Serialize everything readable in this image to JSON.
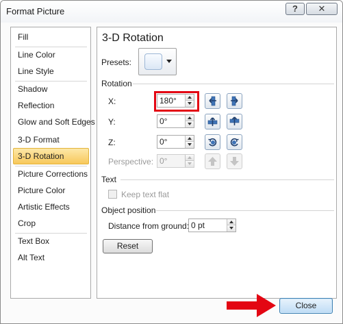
{
  "window": {
    "title": "Format Picture",
    "help_glyph": "?",
    "close_glyph": "✕"
  },
  "sidebar": {
    "items": [
      {
        "label": "Fill"
      },
      {
        "label": "Line Color"
      },
      {
        "label": "Line Style"
      },
      {
        "label": "Shadow"
      },
      {
        "label": "Reflection"
      },
      {
        "label": "Glow and Soft Edges"
      },
      {
        "label": "3-D Format"
      },
      {
        "label": "3-D Rotation",
        "selected": true
      },
      {
        "label": "Picture Corrections"
      },
      {
        "label": "Picture Color"
      },
      {
        "label": "Artistic Effects"
      },
      {
        "label": "Crop"
      },
      {
        "label": "Text Box"
      },
      {
        "label": "Alt Text"
      }
    ]
  },
  "panel": {
    "title": "3-D Rotation",
    "presets_label": "Presets:",
    "rotation_section": "Rotation",
    "x_label": "X:",
    "x_value": "180°",
    "y_label": "Y:",
    "y_value": "0°",
    "z_label": "Z:",
    "z_value": "0°",
    "perspective_label": "Perspective:",
    "perspective_value": "0°",
    "text_section": "Text",
    "keep_text_flat_label": "Keep text flat",
    "keep_text_flat_checked": false,
    "object_position_section": "Object position",
    "distance_label": "Distance from ground:",
    "distance_value": "0 pt",
    "reset_label": "Reset"
  },
  "footer": {
    "close_label": "Close"
  },
  "colors": {
    "highlight": "#e30613",
    "selected_item": "#f7c85b",
    "default_button": "#bfdcf5"
  }
}
